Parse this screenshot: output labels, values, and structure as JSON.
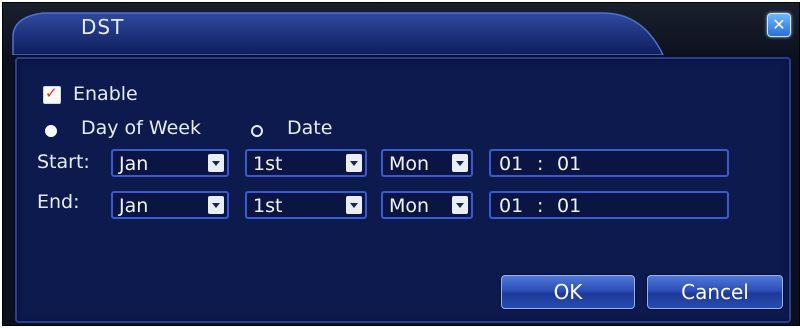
{
  "dialog": {
    "title": "DST",
    "close_icon": "close-icon"
  },
  "enable": {
    "label": "Enable",
    "checked": true
  },
  "mode": {
    "options": [
      {
        "label": "Day of Week",
        "selected": true
      },
      {
        "label": "Date",
        "selected": false
      }
    ]
  },
  "start": {
    "label": "Start:",
    "month": "Jan",
    "week": "1st",
    "day": "Mon",
    "hour": "01",
    "sep": ":",
    "minute": "01"
  },
  "end": {
    "label": "End:",
    "month": "Jan",
    "week": "1st",
    "day": "Mon",
    "hour": "01",
    "sep": ":",
    "minute": "01"
  },
  "buttons": {
    "ok": "OK",
    "cancel": "Cancel"
  },
  "colors": {
    "panel_bg": "#0d1a4d",
    "border": "#3a5ad0",
    "check_mark": "#e0312b",
    "button_accent": "#2c4fb8"
  }
}
